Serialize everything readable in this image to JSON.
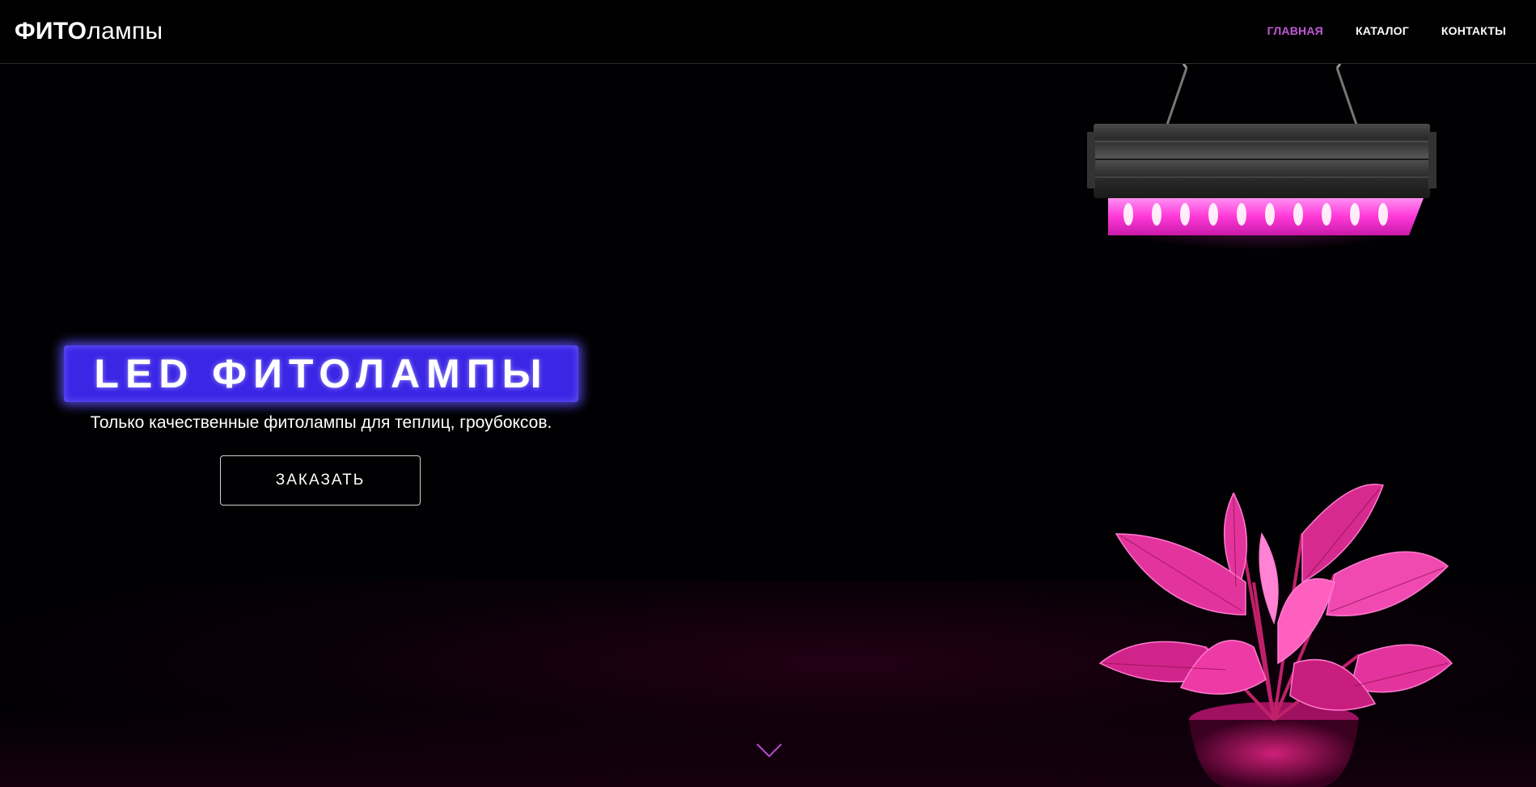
{
  "header": {
    "logo_bold": "ФИТО",
    "logo_light": "лампы",
    "nav": [
      {
        "label": "ГЛАВНАЯ",
        "active": true
      },
      {
        "label": "КАТАЛОГ",
        "active": false
      },
      {
        "label": "КОНТАКТЫ",
        "active": false
      }
    ]
  },
  "hero": {
    "title": "LED ФИТОЛАМПЫ",
    "subtitle": "Только качественные фитолампы для теплиц, гроубоксов.",
    "button_label": "ЗАКАЗАТЬ"
  },
  "colors": {
    "accent": "#c15ad6",
    "title_bg": "#3b26e6",
    "background": "#000000"
  },
  "icons": {
    "scroll": "chevron-down-icon"
  }
}
